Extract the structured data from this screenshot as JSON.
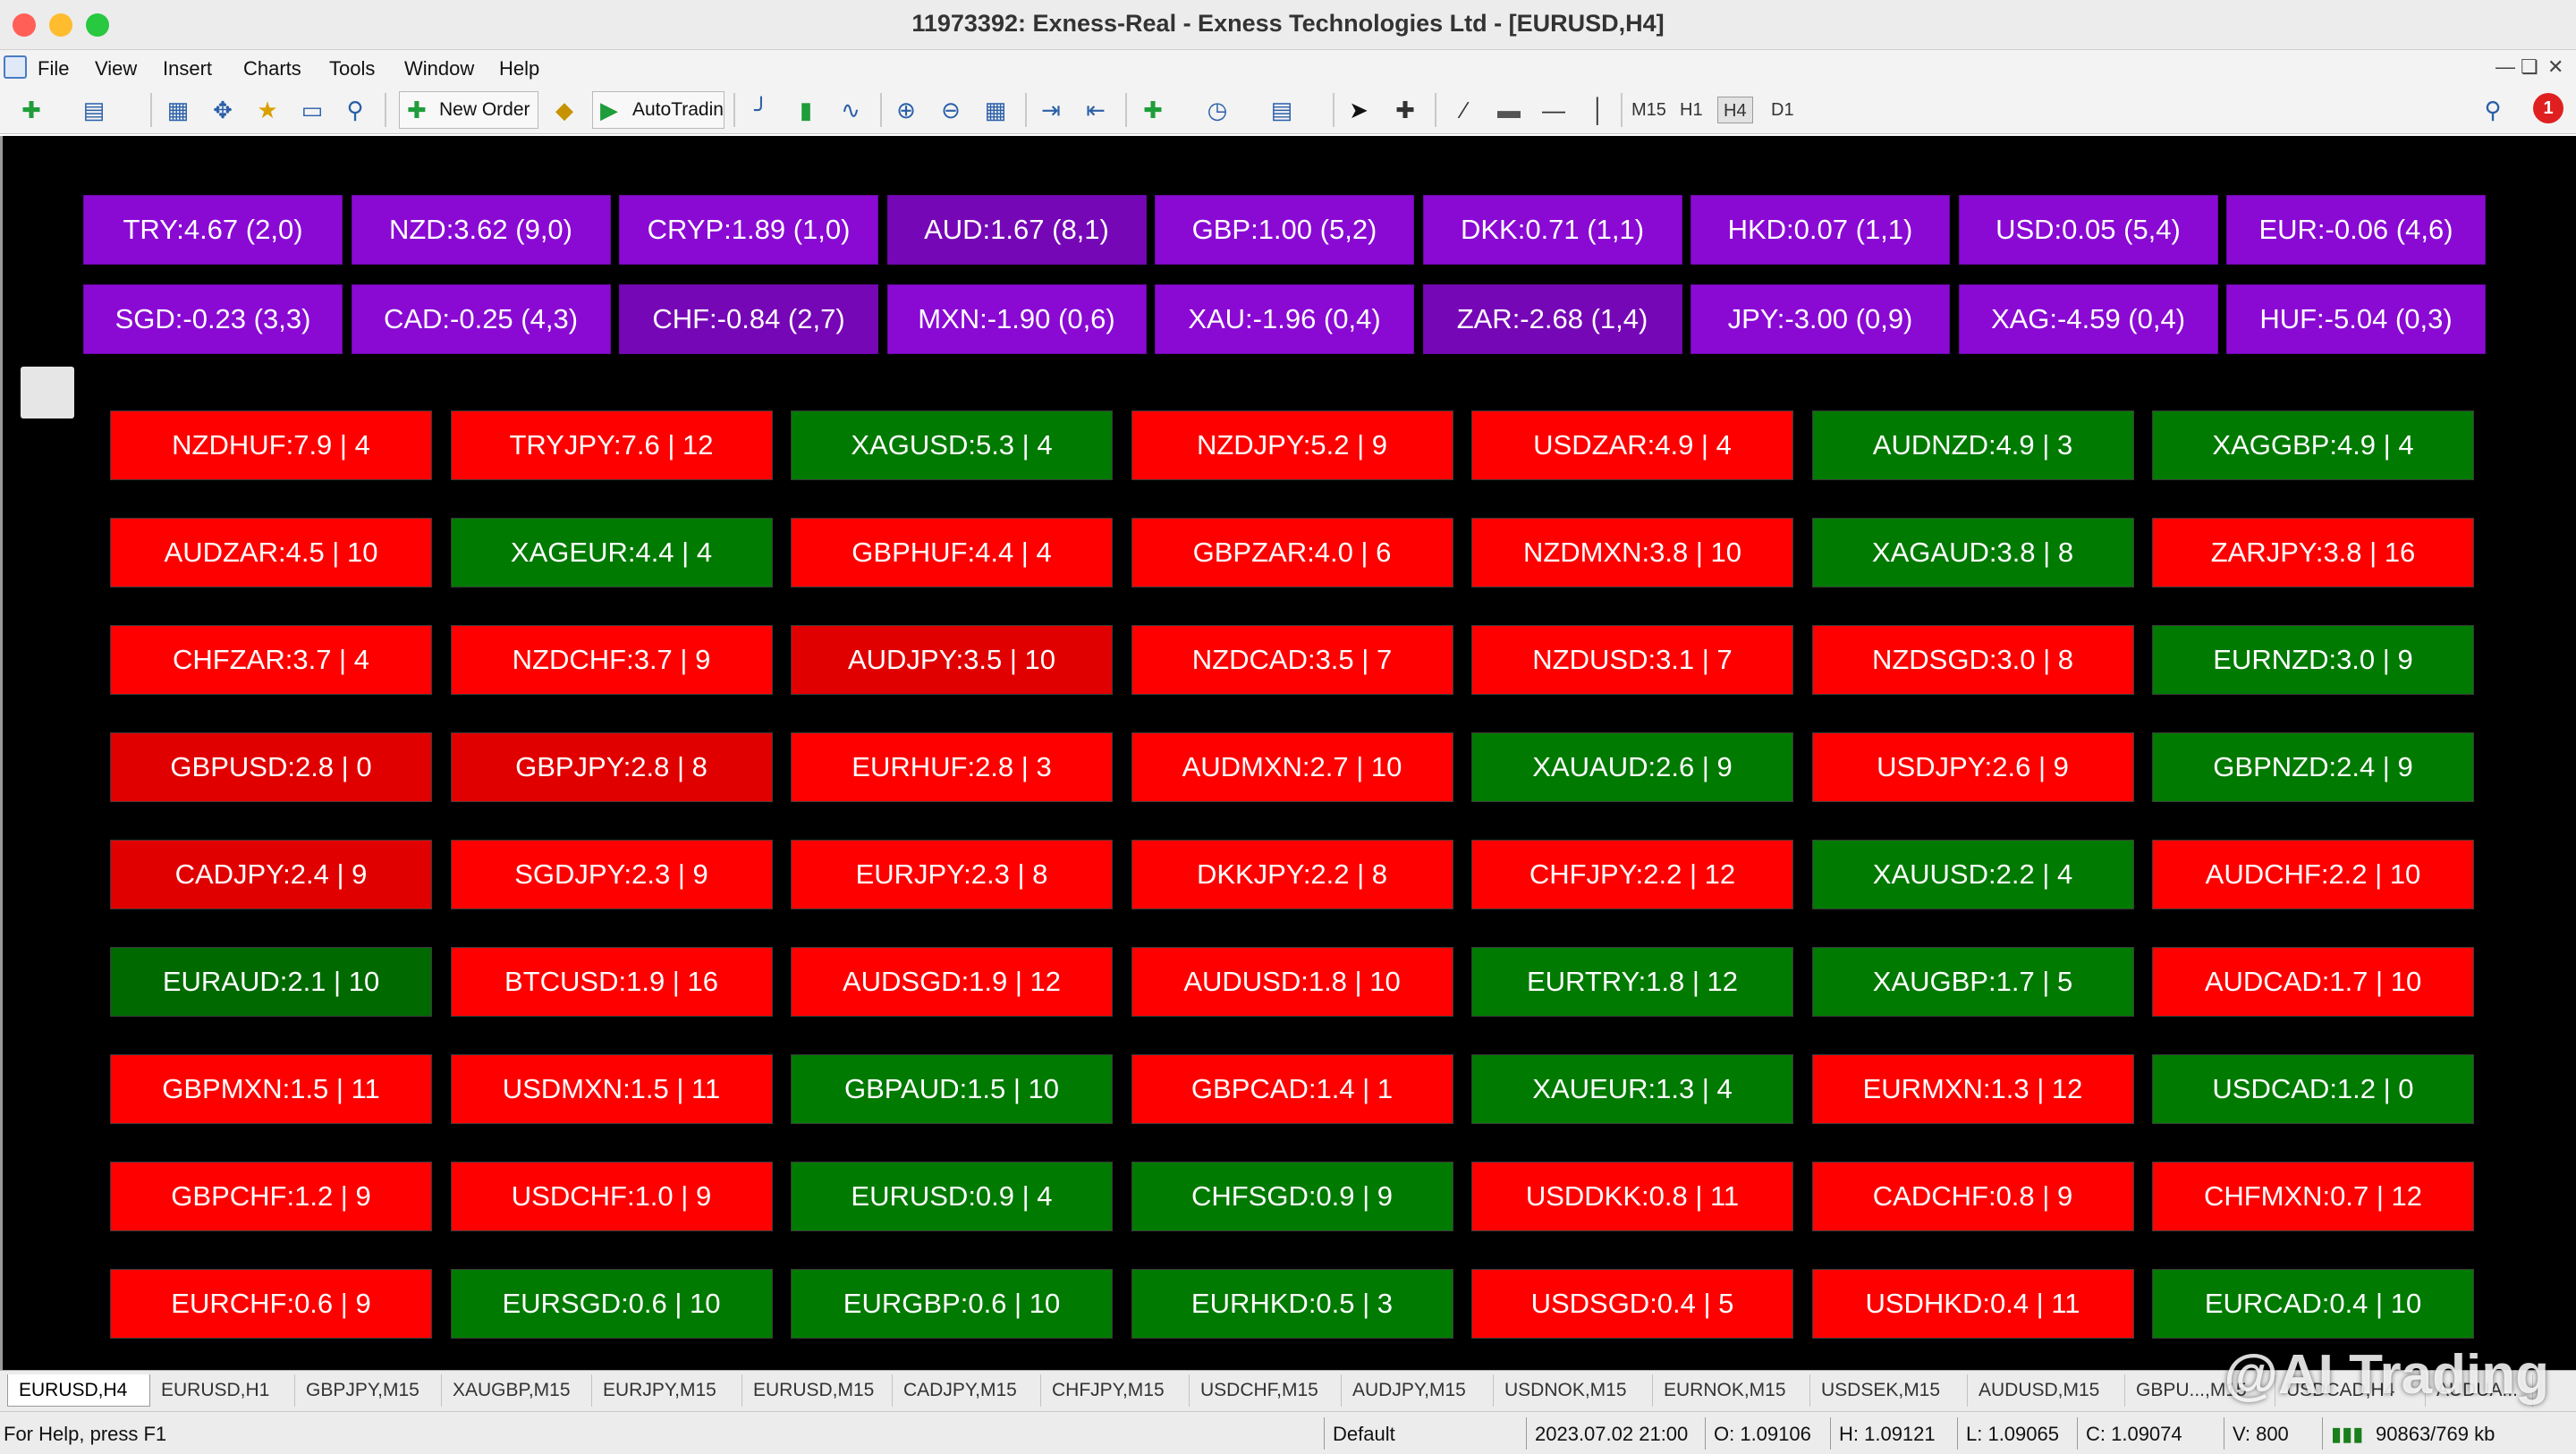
{
  "window": {
    "title": "11973392: Exness-Real - Exness Technologies Ltd - [EURUSD,H4]"
  },
  "menu": [
    "File",
    "View",
    "Insert",
    "Charts",
    "Tools",
    "Window",
    "Help"
  ],
  "toolbar": {
    "new_order": "New Order",
    "autotrading": "AutoTradin",
    "timeframes": [
      "M15",
      "H1",
      "H4",
      "D1"
    ],
    "active_timeframe": "H4",
    "notification_count": "1"
  },
  "colors": {
    "chart_bg": "#000000",
    "currency_purple": "#8a0ad4",
    "currency_purple_dark": "#7607b6",
    "pair_red": "#ff0000",
    "pair_red_dark": "#e10000",
    "pair_green": "#007a00",
    "pair_green_dark": "#006a00"
  },
  "currency_strength": [
    [
      "TRY:4.67 (2,0)",
      "NZD:3.62 (9,0)",
      "CRYP:1.89 (1,0)",
      "AUD:1.67 (8,1)",
      "GBP:1.00 (5,2)",
      "DKK:0.71 (1,1)",
      "HKD:0.07 (1,1)",
      "USD:0.05 (5,4)",
      "EUR:-0.06 (4,6)"
    ],
    [
      "SGD:-0.23 (3,3)",
      "CAD:-0.25 (4,3)",
      "CHF:-0.84 (2,7)",
      "MXN:-1.90 (0,6)",
      "XAU:-1.96 (0,4)",
      "ZAR:-2.68 (1,4)",
      "JPY:-3.00 (0,9)",
      "XAG:-4.59 (0,4)",
      "HUF:-5.04 (0,3)"
    ]
  ],
  "currency_shade": [
    [
      "l",
      "l",
      "l",
      "d",
      "l",
      "l",
      "l",
      "l",
      "l"
    ],
    [
      "l",
      "l",
      "d",
      "l",
      "l",
      "d",
      "l",
      "l",
      "l"
    ]
  ],
  "pairs": [
    [
      {
        "t": "NZDHUF:7.9 | 4",
        "c": "red"
      },
      {
        "t": "TRYJPY:7.6 | 12",
        "c": "red"
      },
      {
        "t": "XAGUSD:5.3 | 4",
        "c": "green"
      },
      {
        "t": "NZDJPY:5.2 | 9",
        "c": "red"
      },
      {
        "t": "USDZAR:4.9 | 4",
        "c": "red"
      },
      {
        "t": "AUDNZD:4.9 | 3",
        "c": "green"
      },
      {
        "t": "XAGGBP:4.9 | 4",
        "c": "green"
      }
    ],
    [
      {
        "t": "AUDZAR:4.5 | 10",
        "c": "red"
      },
      {
        "t": "XAGEUR:4.4 | 4",
        "c": "green"
      },
      {
        "t": "GBPHUF:4.4 | 4",
        "c": "red"
      },
      {
        "t": "GBPZAR:4.0 | 6",
        "c": "red"
      },
      {
        "t": "NZDMXN:3.8 | 10",
        "c": "red"
      },
      {
        "t": "XAGAUD:3.8 | 8",
        "c": "green"
      },
      {
        "t": "ZARJPY:3.8 | 16",
        "c": "red"
      }
    ],
    [
      {
        "t": "CHFZAR:3.7 | 4",
        "c": "red"
      },
      {
        "t": "NZDCHF:3.7 | 9",
        "c": "red"
      },
      {
        "t": "AUDJPY:3.5 | 10",
        "c": "reddark"
      },
      {
        "t": "NZDCAD:3.5 | 7",
        "c": "red"
      },
      {
        "t": "NZDUSD:3.1 | 7",
        "c": "red"
      },
      {
        "t": "NZDSGD:3.0 | 8",
        "c": "red"
      },
      {
        "t": "EURNZD:3.0 | 9",
        "c": "green"
      }
    ],
    [
      {
        "t": "GBPUSD:2.8 | 0",
        "c": "reddark"
      },
      {
        "t": "GBPJPY:2.8 | 8",
        "c": "reddark"
      },
      {
        "t": "EURHUF:2.8 | 3",
        "c": "red"
      },
      {
        "t": "AUDMXN:2.7 | 10",
        "c": "red"
      },
      {
        "t": "XAUAUD:2.6 | 9",
        "c": "green"
      },
      {
        "t": "USDJPY:2.6 | 9",
        "c": "red"
      },
      {
        "t": "GBPNZD:2.4 | 9",
        "c": "green"
      }
    ],
    [
      {
        "t": "CADJPY:2.4 | 9",
        "c": "reddark"
      },
      {
        "t": "SGDJPY:2.3 | 9",
        "c": "red"
      },
      {
        "t": "EURJPY:2.3 | 8",
        "c": "red"
      },
      {
        "t": "DKKJPY:2.2 | 8",
        "c": "red"
      },
      {
        "t": "CHFJPY:2.2 | 12",
        "c": "red"
      },
      {
        "t": "XAUUSD:2.2 | 4",
        "c": "green"
      },
      {
        "t": "AUDCHF:2.2 | 10",
        "c": "red"
      }
    ],
    [
      {
        "t": "EURAUD:2.1 | 10",
        "c": "greendark"
      },
      {
        "t": "BTCUSD:1.9 | 16",
        "c": "red"
      },
      {
        "t": "AUDSGD:1.9 | 12",
        "c": "red"
      },
      {
        "t": "AUDUSD:1.8 | 10",
        "c": "red"
      },
      {
        "t": "EURTRY:1.8 | 12",
        "c": "green"
      },
      {
        "t": "XAUGBP:1.7 | 5",
        "c": "green"
      },
      {
        "t": "AUDCAD:1.7 | 10",
        "c": "red"
      }
    ],
    [
      {
        "t": "GBPMXN:1.5 | 11",
        "c": "red"
      },
      {
        "t": "USDMXN:1.5 | 11",
        "c": "red"
      },
      {
        "t": "GBPAUD:1.5 | 10",
        "c": "green"
      },
      {
        "t": "GBPCAD:1.4 | 1",
        "c": "red"
      },
      {
        "t": "XAUEUR:1.3 | 4",
        "c": "green"
      },
      {
        "t": "EURMXN:1.3 | 12",
        "c": "red"
      },
      {
        "t": "USDCAD:1.2 | 0",
        "c": "green"
      }
    ],
    [
      {
        "t": "GBPCHF:1.2 | 9",
        "c": "red"
      },
      {
        "t": "USDCHF:1.0 | 9",
        "c": "red"
      },
      {
        "t": "EURUSD:0.9 | 4",
        "c": "green"
      },
      {
        "t": "CHFSGD:0.9 | 9",
        "c": "green"
      },
      {
        "t": "USDDKK:0.8 | 11",
        "c": "red"
      },
      {
        "t": "CADCHF:0.8 | 9",
        "c": "red"
      },
      {
        "t": "CHFMXN:0.7 | 12",
        "c": "red"
      }
    ],
    [
      {
        "t": "EURCHF:0.6 | 9",
        "c": "red"
      },
      {
        "t": "EURSGD:0.6 | 10",
        "c": "green"
      },
      {
        "t": "EURGBP:0.6 | 10",
        "c": "green"
      },
      {
        "t": "EURHKD:0.5 | 3",
        "c": "green"
      },
      {
        "t": "USDSGD:0.4 | 5",
        "c": "red"
      },
      {
        "t": "USDHKD:0.4 | 11",
        "c": "red"
      },
      {
        "t": "EURCAD:0.4 | 10",
        "c": "green"
      }
    ]
  ],
  "tabs": [
    "EURUSD,H4",
    "EURUSD,H1",
    "GBPJPY,M15",
    "XAUGBP,M15",
    "EURJPY,M15",
    "EURUSD,M15",
    "CADJPY,M15",
    "CHFJPY,M15",
    "USDCHF,M15",
    "AUDJPY,M15",
    "USDNOK,M15",
    "EURNOK,M15",
    "USDSEK,M15",
    "AUDUSD,M15",
    "GBPU...,M15",
    "USDCAD,H4",
    "AUDUA..."
  ],
  "active_tab": "EURUSD,H4",
  "watermark": "@AI Trading",
  "status": {
    "help": "For Help, press F1",
    "profile": "Default",
    "datetime": "2023.07.02 21:00",
    "open": "O: 1.09106",
    "high": "H: 1.09121",
    "low": "L: 1.09065",
    "close": "C: 1.09074",
    "volume": "V: 800",
    "traffic": "90863/769 kb"
  }
}
